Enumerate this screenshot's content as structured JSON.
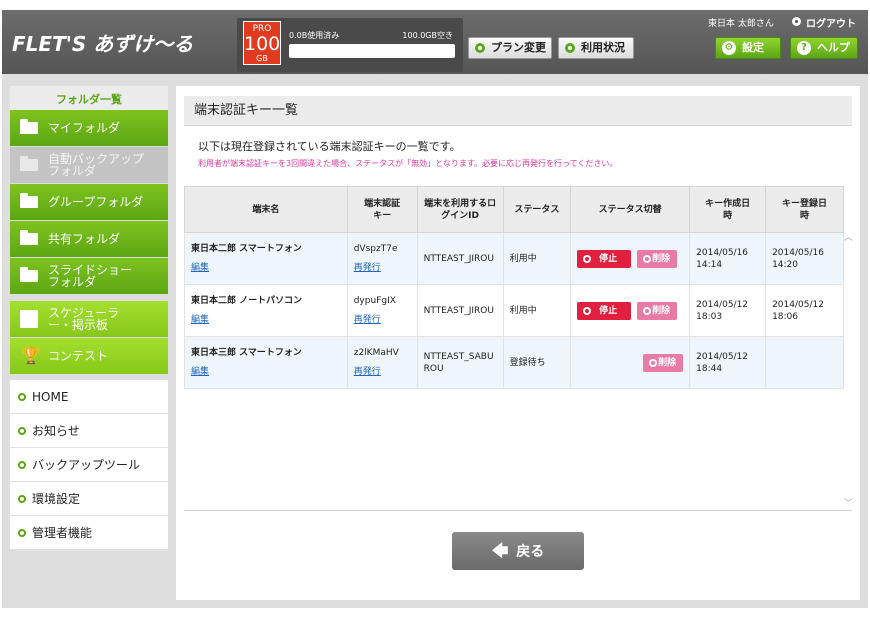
{
  "header": {
    "logo_text": "FLET'S あずけ〜る",
    "plan": {
      "line1": "PRO",
      "line2": "100",
      "line3": "GB"
    },
    "usage_label": "0.0B使用済み",
    "free_label": "100.0GB空き",
    "usage_fraction": 0.0,
    "plan_change_label": "プラン変更",
    "usage_status_label": "利用状況",
    "user_name": "東日本 太郎さん",
    "logout_label": "ログアウト",
    "settings_label": "設定",
    "help_label": "ヘルプ"
  },
  "sidebar": {
    "title": "フォルダ一覧",
    "folders": [
      {
        "label": "マイフォルダ"
      },
      {
        "label": "自動バックアップフォルダ"
      },
      {
        "label": "グループフォルダ"
      },
      {
        "label": "共有フォルダ"
      },
      {
        "label": "スライドショーフォルダ"
      }
    ],
    "extras": [
      {
        "label": "スケジューラー・掲示板"
      },
      {
        "label": "コンテスト"
      }
    ],
    "nav": [
      {
        "label": "HOME"
      },
      {
        "label": "お知らせ"
      },
      {
        "label": "バックアップツール"
      },
      {
        "label": "環境設定"
      },
      {
        "label": "管理者機能"
      }
    ]
  },
  "main": {
    "title": "端末認証キー一覧",
    "description": "以下は現在登録されている端末認証キーの一覧です。",
    "note": "利用者が端末認証キーを3回間違えた場合、ステータスが「無効」となります。必要に応じ再発行を行ってください。",
    "columns": [
      "端末名",
      "端末認証キー",
      "端末を利用するログインID",
      "ステータス",
      "ステータス切替",
      "キー作成日時",
      "キー登録日時"
    ],
    "edit_label": "編集",
    "reissue_label": "再発行",
    "stop_label": "停止",
    "delete_label": "削除",
    "rows": [
      {
        "name": "東日本二郎 スマートフォン",
        "key": "dVspzT7e",
        "login_id": "NTTEAST_JIROU",
        "status": "利用中",
        "created": "2014/05/16 14:14",
        "registered": "2014/05/16 14:20"
      },
      {
        "name": "東日本二郎 ノートパソコン",
        "key": "dypuFgIX",
        "login_id": "NTTEAST_JIROU",
        "status": "利用中",
        "created": "2014/05/12 18:03",
        "registered": "2014/05/12 18:06"
      },
      {
        "name": "東日本三郎 スマートフォン",
        "key": "z2lKMaHV",
        "login_id": "NTTEAST_SABUROU",
        "status": "登録待ち",
        "created": "2014/05/12 18:44",
        "registered": ""
      }
    ],
    "back_label": "戻る"
  }
}
